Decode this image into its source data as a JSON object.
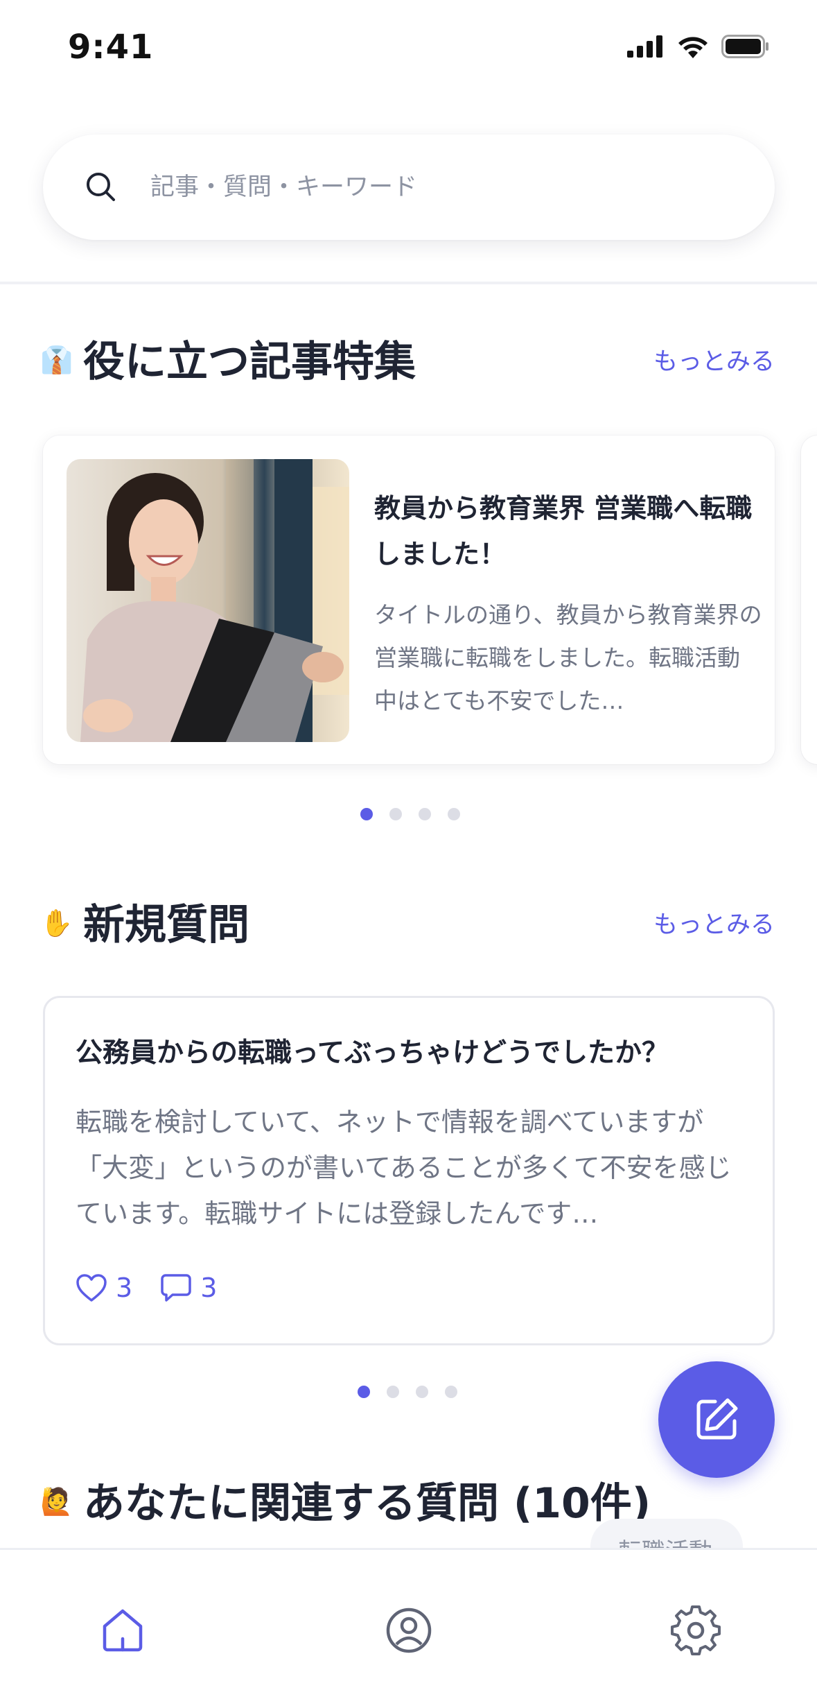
{
  "status_bar": {
    "time": "9:41",
    "icons": [
      "signal-icon",
      "wifi-icon",
      "battery-icon"
    ]
  },
  "search": {
    "placeholder": "記事・質問・キーワード",
    "icon": "search-icon"
  },
  "featured_articles": {
    "emoji": "👔",
    "title": "役に立つ記事特集",
    "more_label": "もっとみる",
    "cards": [
      {
        "title": "教員から教育業界 営業職へ転職しました！",
        "excerpt": "タイトルの通り、教員から教育業界の営業職に転職をしました。転職活動中はとても不安でした…"
      }
    ],
    "pagination": {
      "count": 4,
      "active_index": 0
    }
  },
  "new_questions": {
    "emoji": "✋",
    "title": "新規質問",
    "more_label": "もっとみる",
    "cards": [
      {
        "title": "公務員からの転職ってぶっちゃけどうでしたか？",
        "body": "転職を検討していて、ネットで情報を調べていますが「大変」というのが書いてあることが多くて不安を感じています。転職サイトには登録したんです…",
        "likes": "3",
        "comments": "3"
      }
    ],
    "pagination": {
      "count": 4,
      "active_index": 0
    }
  },
  "related_questions": {
    "emoji": "🙋",
    "title": "あなたに関連する質問 (10件)",
    "tag_peek": "転職活動"
  },
  "fab": {
    "icon": "edit-icon"
  },
  "bottom_nav": {
    "items": [
      {
        "name": "home",
        "icon": "home-icon",
        "active": true
      },
      {
        "name": "profile",
        "icon": "user-circle-icon",
        "active": false
      },
      {
        "name": "settings",
        "icon": "gear-icon",
        "active": false
      }
    ]
  },
  "colors": {
    "accent": "#5b5ce6",
    "text_primary": "#1f2433",
    "text_secondary": "#6f7585",
    "nav_inactive": "#5f6475"
  }
}
